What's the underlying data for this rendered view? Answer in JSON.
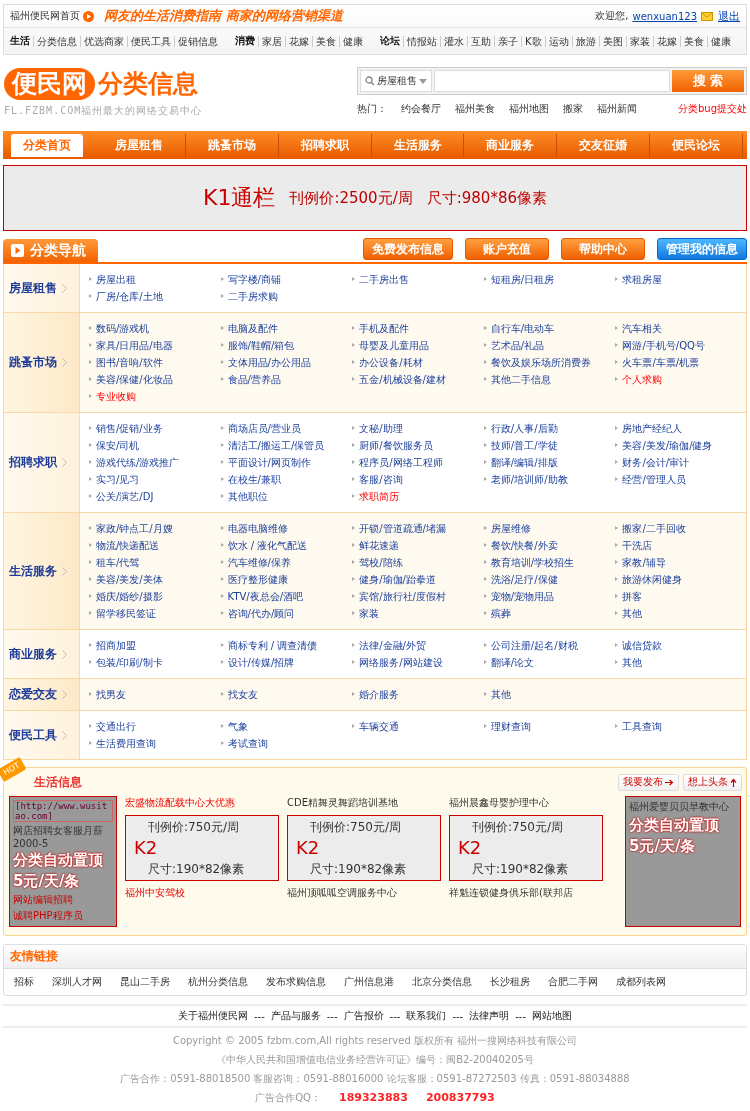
{
  "topbar": {
    "home_link": "福州便民网首页",
    "slogan": "网友的生活消费指南 商家的网络营销渠道",
    "welcome": "欢迎您,",
    "username": "wenxuan123",
    "logout": "退出"
  },
  "quick_nav": [
    {
      "title": "生活",
      "links": [
        "分类信息",
        "优选商家",
        "便民工具",
        "促销信息"
      ]
    },
    {
      "title": "消费",
      "links": [
        "家居",
        "花嫁",
        "美食",
        "健康"
      ]
    },
    {
      "title": "论坛",
      "links": [
        "情报站",
        "灌水",
        "互助",
        "亲子",
        "K歌",
        "运动",
        "旅游",
        "美图",
        "家装",
        "花嫁",
        "美食",
        "健康"
      ]
    }
  ],
  "header": {
    "logo_mark": "便民网",
    "logo_title": "分类信息",
    "logo_subtitle": "FL.FZBM.COM福州最大的网络交易中心",
    "search_category": "房屋租售",
    "search_button": "搜 索",
    "hot_label": "热门：",
    "hot_links": [
      "约会餐厅",
      "福州美食",
      "福州地图",
      "搬家",
      "福州新闻"
    ],
    "bug_link": "分类bug提交处"
  },
  "main_nav": [
    {
      "label": "分类首页",
      "selected": true
    },
    {
      "label": "房屋租售",
      "selected": false
    },
    {
      "label": "跳蚤市场",
      "selected": false
    },
    {
      "label": "招聘求职",
      "selected": false
    },
    {
      "label": "生活服务",
      "selected": false
    },
    {
      "label": "商业服务",
      "selected": false
    },
    {
      "label": "交友征婚",
      "selected": false
    },
    {
      "label": "便民论坛",
      "selected": false
    }
  ],
  "banner": {
    "title": "K1通栏",
    "price": "刊例价:2500元/周",
    "size": "尺寸:980*86像素"
  },
  "category_nav": {
    "title": "分类导航",
    "actions": [
      {
        "label": "免费发布信息",
        "kind": "orange"
      },
      {
        "label": "账户充值",
        "kind": "orange"
      },
      {
        "label": "帮助中心",
        "kind": "orange"
      },
      {
        "label": "管理我的信息",
        "kind": "blue"
      }
    ],
    "sections": [
      {
        "title": "房屋租售",
        "items": [
          {
            "label": "房屋出租",
            "highlight": false
          },
          {
            "label": "写字楼/商铺",
            "highlight": false
          },
          {
            "label": "二手房出售",
            "highlight": false
          },
          {
            "label": "短租房/日租房",
            "highlight": false
          },
          {
            "label": "求租房屋",
            "highlight": false
          },
          {
            "label": "厂房/仓库/土地",
            "highlight": false
          },
          {
            "label": "二手房求购",
            "highlight": false
          }
        ]
      },
      {
        "title": "跳蚤市场",
        "items": [
          {
            "label": "数码/游戏机",
            "highlight": false
          },
          {
            "label": "电脑及配件",
            "highlight": false
          },
          {
            "label": "手机及配件",
            "highlight": false
          },
          {
            "label": "自行车/电动车",
            "highlight": false
          },
          {
            "label": "汽车相关",
            "highlight": false
          },
          {
            "label": "家具/日用品/电器",
            "highlight": false
          },
          {
            "label": "服饰/鞋帽/箱包",
            "highlight": false
          },
          {
            "label": "母婴及儿童用品",
            "highlight": false
          },
          {
            "label": "艺术品/礼品",
            "highlight": false
          },
          {
            "label": "网游/手机号/QQ号",
            "highlight": false
          },
          {
            "label": "图书/音响/软件",
            "highlight": false
          },
          {
            "label": "文体用品/办公用品",
            "highlight": false
          },
          {
            "label": "办公设备/耗材",
            "highlight": false
          },
          {
            "label": "餐饮及娱乐场所消费券",
            "highlight": false
          },
          {
            "label": "火车票/车票/机票",
            "highlight": false
          },
          {
            "label": "美容/保健/化妆品",
            "highlight": false
          },
          {
            "label": "食品/营养品",
            "highlight": false
          },
          {
            "label": "五金/机械设备/建材",
            "highlight": false
          },
          {
            "label": "其他二手信息",
            "highlight": false
          },
          {
            "label": "个人求购",
            "highlight": true
          },
          {
            "label": "专业收购",
            "highlight": true
          }
        ]
      },
      {
        "title": "招聘求职",
        "items": [
          {
            "label": "销售/促销/业务",
            "highlight": false
          },
          {
            "label": "商场店员/营业员",
            "highlight": false
          },
          {
            "label": "文秘/助理",
            "highlight": false
          },
          {
            "label": "行政/人事/后勤",
            "highlight": false
          },
          {
            "label": "房地产经纪人",
            "highlight": false
          },
          {
            "label": "保安/司机",
            "highlight": false
          },
          {
            "label": "清洁工/搬运工/保管员",
            "highlight": false
          },
          {
            "label": "厨师/餐饮服务员",
            "highlight": false
          },
          {
            "label": "技师/普工/学徒",
            "highlight": false
          },
          {
            "label": "美容/美发/瑜伽/健身",
            "highlight": false
          },
          {
            "label": "游戏代练/游戏推广",
            "highlight": false
          },
          {
            "label": "平面设计/网页制作",
            "highlight": false
          },
          {
            "label": "程序员/网络工程师",
            "highlight": false
          },
          {
            "label": "翻译/编辑/排版",
            "highlight": false
          },
          {
            "label": "财务/会计/审计",
            "highlight": false
          },
          {
            "label": "实习/见习",
            "highlight": false
          },
          {
            "label": "在校生/兼职",
            "highlight": false
          },
          {
            "label": "客服/咨询",
            "highlight": false
          },
          {
            "label": "老师/培训师/助教",
            "highlight": false
          },
          {
            "label": "经营/管理人员",
            "highlight": false
          },
          {
            "label": "公关/演艺/DJ",
            "highlight": false
          },
          {
            "label": "其他职位",
            "highlight": false
          },
          {
            "label": "求职简历",
            "highlight": true
          }
        ]
      },
      {
        "title": "生活服务",
        "items": [
          {
            "label": "家政/钟点工/月嫂",
            "highlight": false
          },
          {
            "label": "电器电脑维修",
            "highlight": false
          },
          {
            "label": "开锁/管道疏通/堵漏",
            "highlight": false
          },
          {
            "label": "房屋维修",
            "highlight": false
          },
          {
            "label": "搬家/二手回收",
            "highlight": false
          },
          {
            "label": "物流/快递配送",
            "highlight": false
          },
          {
            "label": "饮水 / 液化气配送",
            "highlight": false
          },
          {
            "label": "鲜花速递",
            "highlight": false
          },
          {
            "label": "餐饮/快餐/外卖",
            "highlight": false
          },
          {
            "label": "干洗店",
            "highlight": false
          },
          {
            "label": "租车/代驾",
            "highlight": false
          },
          {
            "label": "汽车维修/保养",
            "highlight": false
          },
          {
            "label": "驾校/陪练",
            "highlight": false
          },
          {
            "label": "教育培训/学校招生",
            "highlight": false
          },
          {
            "label": "家教/辅导",
            "highlight": false
          },
          {
            "label": "美容/美发/美体",
            "highlight": false
          },
          {
            "label": "医疗整形健康",
            "highlight": false
          },
          {
            "label": "健身/瑜伽/跆拳道",
            "highlight": false
          },
          {
            "label": "洗浴/足疗/保健",
            "highlight": false
          },
          {
            "label": "旅游休闲健身",
            "highlight": false
          },
          {
            "label": "婚庆/婚纱/摄影",
            "highlight": false
          },
          {
            "label": "KTV/夜总会/酒吧",
            "highlight": false
          },
          {
            "label": "宾馆/旅行社/度假村",
            "highlight": false
          },
          {
            "label": "宠物/宠物用品",
            "highlight": false
          },
          {
            "label": "拼客",
            "highlight": false
          },
          {
            "label": "留学移民签证",
            "highlight": false
          },
          {
            "label": "咨询/代办/顾问",
            "highlight": false
          },
          {
            "label": "家装",
            "highlight": false
          },
          {
            "label": "殡葬",
            "highlight": false
          },
          {
            "label": "其他",
            "highlight": false
          }
        ]
      },
      {
        "title": "商业服务",
        "items": [
          {
            "label": "招商加盟",
            "highlight": false
          },
          {
            "label": "商标专利 / 调查清债",
            "highlight": false
          },
          {
            "label": "法律/金融/外贸",
            "highlight": false
          },
          {
            "label": "公司注册/起名/财税",
            "highlight": false
          },
          {
            "label": "诚信贷款",
            "highlight": false
          },
          {
            "label": "包装/印刷/制卡",
            "highlight": false
          },
          {
            "label": "设计/传媒/招牌",
            "highlight": false
          },
          {
            "label": "网络服务/网站建设",
            "highlight": false
          },
          {
            "label": "翻译/论文",
            "highlight": false
          },
          {
            "label": "其他",
            "highlight": false
          }
        ]
      },
      {
        "title": "恋爱交友",
        "items": [
          {
            "label": "找男友",
            "highlight": false
          },
          {
            "label": "找女友",
            "highlight": false
          },
          {
            "label": "婚介服务",
            "highlight": false
          },
          {
            "label": "其他",
            "highlight": false
          }
        ]
      },
      {
        "title": "便民工具",
        "items": [
          {
            "label": "交通出行",
            "highlight": false
          },
          {
            "label": "气象",
            "highlight": false
          },
          {
            "label": "车辆交通",
            "highlight": false
          },
          {
            "label": "理财查询",
            "highlight": false
          },
          {
            "label": "工具查询",
            "highlight": false
          },
          {
            "label": "生活费用查询",
            "highlight": false
          },
          {
            "label": "考试查询",
            "highlight": false
          }
        ]
      }
    ]
  },
  "life_info": {
    "badge": "HOT",
    "title": "生活信息",
    "actions": [
      {
        "label": "我要发布",
        "kind": "publish"
      },
      {
        "label": "想上头条",
        "kind": "headline"
      }
    ],
    "left_ad": {
      "url": "[http://www.wusitao.com]",
      "teaser": "网店招聘女客服月薪2000-5",
      "promo": "分类自动置顶",
      "price": "5元/天/条",
      "links": [
        "网站编辑招聘",
        "诚聘PHP程序员"
      ]
    },
    "columns": [
      {
        "title": "宏盛物流配载中心大优惠",
        "highlight": true,
        "ad_price": "刊例价:750元/周",
        "ad_code": "K2",
        "ad_size": "尺寸:190*82像素",
        "footer": "福州中安驾校"
      },
      {
        "title": "CDE精舞灵舞蹈培训基地",
        "highlight": false,
        "ad_price": "刊例价:750元/周",
        "ad_code": "K2",
        "ad_size": "尺寸:190*82像素",
        "footer": "福州顶呱呱空调服务中心"
      },
      {
        "title": "福州晨鑫母婴护理中心",
        "highlight": false,
        "ad_price": "刊例价:750元/周",
        "ad_code": "K2",
        "ad_size": "尺寸:190*82像素",
        "footer": "祥魁连锁健身俱乐部(联邦店"
      }
    ],
    "right_ad": {
      "teaser": "福州爱婴贝贝早教中心",
      "promo": "分类自动置顶",
      "price": "5元/天/条"
    }
  },
  "friend_links": {
    "title": "友情链接",
    "links": [
      "招标",
      "深圳人才网",
      "昆山二手房",
      "杭州分类信息",
      "发布求购信息",
      "广州信息港",
      "北京分类信息",
      "长沙租房",
      "合肥二手网",
      "成都列表网"
    ]
  },
  "footer": {
    "links": [
      "关于福州便民网",
      "产品与服务",
      "广告报价",
      "联系我们",
      "法律声明",
      "网站地图"
    ],
    "separator": "---",
    "copyright": "Copyright © 2005 fzbm.com,All rights reserved 版权所有  福州一搜网络科技有限公司",
    "license": "《中华人民共和国增值电信业务经营许可证》编号：闽B2-20040205号",
    "contacts": "广告合作：0591-88018500 客服咨询：0591-88016000 论坛客服：0591-87272503 传真：0591-88034888",
    "qq_label": "广告合作QQ：",
    "qq": [
      "189323883",
      "200837793"
    ]
  }
}
